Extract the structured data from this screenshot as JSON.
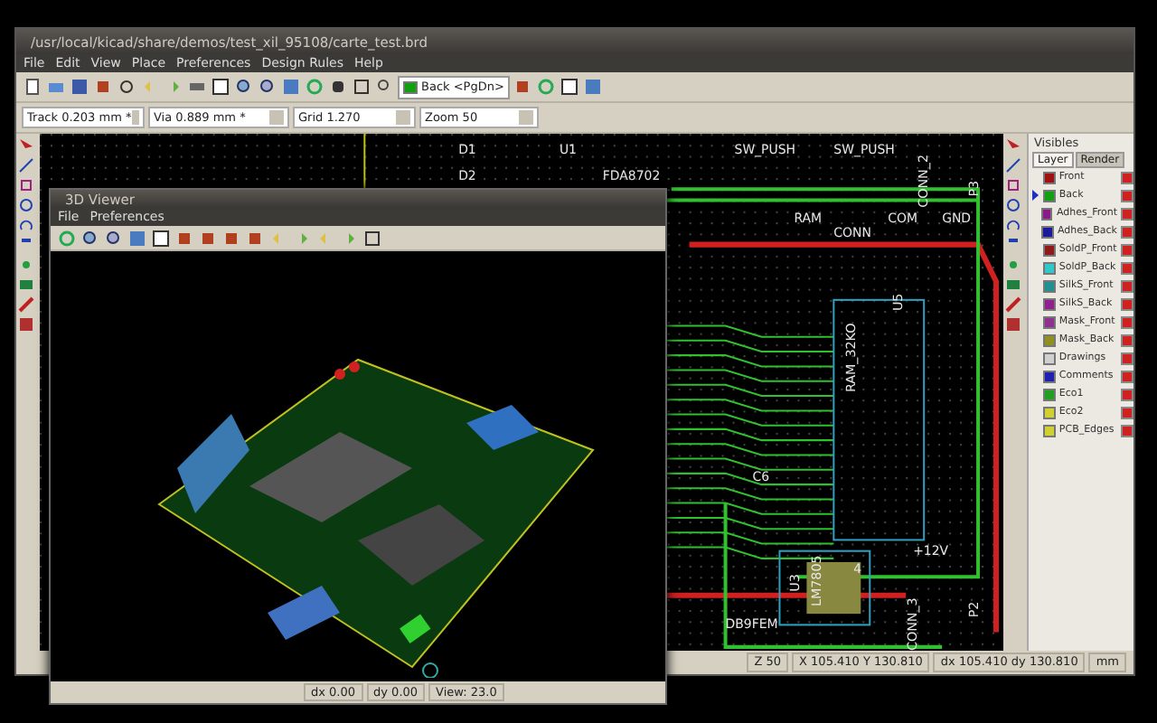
{
  "window": {
    "title": "/usr/local/kicad/share/demos/test_xil_95108/carte_test.brd"
  },
  "menu": [
    "File",
    "Edit",
    "View",
    "Place",
    "Preferences",
    "Design Rules",
    "Help"
  ],
  "layer_select": {
    "value": "Back <PgDn>"
  },
  "fields": [
    {
      "value": "Track 0.203 mm *"
    },
    {
      "value": "Via 0.889 mm *"
    },
    {
      "value": "Grid 1.270"
    },
    {
      "value": "Zoom 50"
    }
  ],
  "pcb_labels": [
    "D1",
    "U1",
    "SW_PUSH",
    "SW_PUSH",
    "D2",
    "FDA8702",
    "P3",
    "CONN_2",
    "RAM",
    "COM",
    "GND",
    "CONN",
    "U5",
    "RAM_32KO",
    "C6",
    "+12V",
    "4",
    "U3",
    "LM7805",
    "DB9FEM",
    "CONN_3",
    "P2"
  ],
  "visibles": {
    "title": "Visibles",
    "tabs": [
      {
        "label": "Layer",
        "selected": true
      },
      {
        "label": "Render",
        "selected": false
      }
    ],
    "layers": [
      {
        "name": "Front",
        "color": "#a01010",
        "visible": true,
        "selected": false
      },
      {
        "name": "Back",
        "color": "#10a010",
        "visible": true,
        "selected": true
      },
      {
        "name": "Adhes_Front",
        "color": "#8a1a8a",
        "visible": true,
        "selected": false
      },
      {
        "name": "Adhes_Back",
        "color": "#1a1a9a",
        "visible": true,
        "selected": false
      },
      {
        "name": "SoldP_Front",
        "color": "#901818",
        "visible": true,
        "selected": false
      },
      {
        "name": "SoldP_Back",
        "color": "#30c8c8",
        "visible": true,
        "selected": false
      },
      {
        "name": "SilkS_Front",
        "color": "#209090",
        "visible": true,
        "selected": false
      },
      {
        "name": "SilkS_Back",
        "color": "#902090",
        "visible": true,
        "selected": false
      },
      {
        "name": "Mask_Front",
        "color": "#903090",
        "visible": true,
        "selected": false
      },
      {
        "name": "Mask_Back",
        "color": "#909020",
        "visible": true,
        "selected": false
      },
      {
        "name": "Drawings",
        "color": "#d0d0d0",
        "visible": true,
        "selected": false
      },
      {
        "name": "Comments",
        "color": "#2020b0",
        "visible": true,
        "selected": false
      },
      {
        "name": "Eco1",
        "color": "#20a020",
        "visible": true,
        "selected": false
      },
      {
        "name": "Eco2",
        "color": "#d0d030",
        "visible": true,
        "selected": false
      },
      {
        "name": "PCB_Edges",
        "color": "#d0d030",
        "visible": true,
        "selected": false
      }
    ]
  },
  "status_bar": [
    "Z 50",
    "X 105.410  Y 130.810",
    "dx 105.410  dy 130.810",
    "mm"
  ],
  "viewer_3d": {
    "title": "3D Viewer",
    "menu": [
      "File",
      "Preferences"
    ],
    "status_bar": [
      "dx 0.00",
      "dy 0.00",
      "View: 23.0"
    ]
  }
}
